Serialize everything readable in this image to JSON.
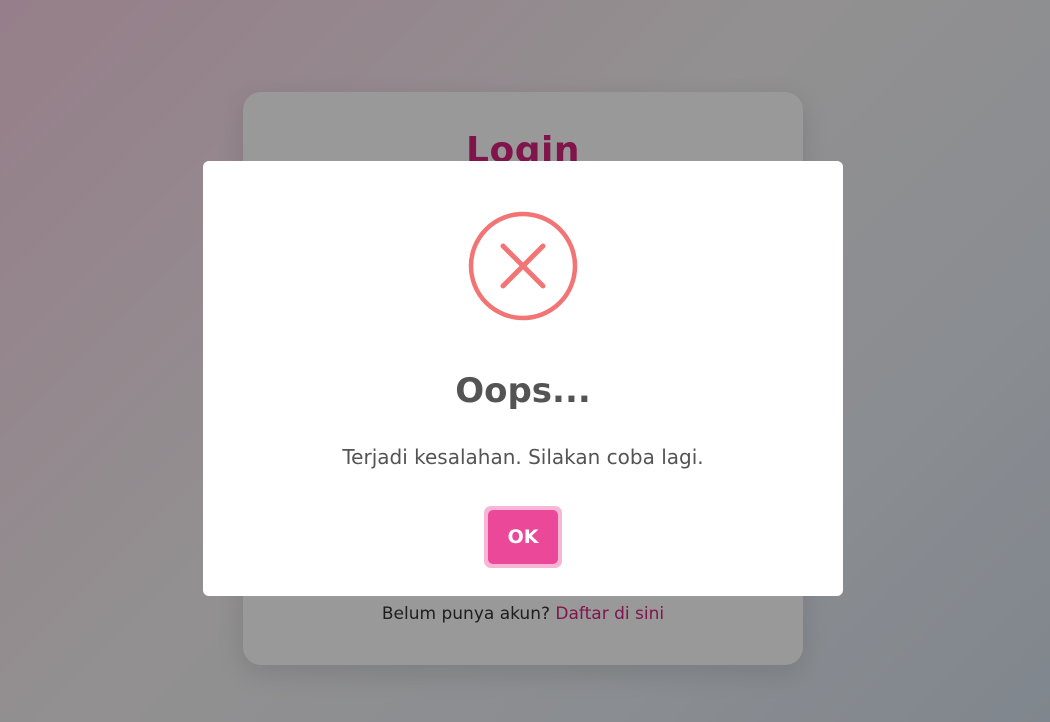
{
  "login": {
    "title": "Login",
    "register_prompt": "Belum punya akun?",
    "register_link": "Daftar di sini"
  },
  "dialog": {
    "icon": "error-x-icon",
    "title": "Oops...",
    "message": "Terjadi kesalahan. Silakan coba lagi.",
    "ok_label": "OK"
  },
  "colors": {
    "accent": "#ec4899",
    "brand_text": "#d6247f",
    "error_icon": "#f27474",
    "dialog_text": "#545454"
  }
}
